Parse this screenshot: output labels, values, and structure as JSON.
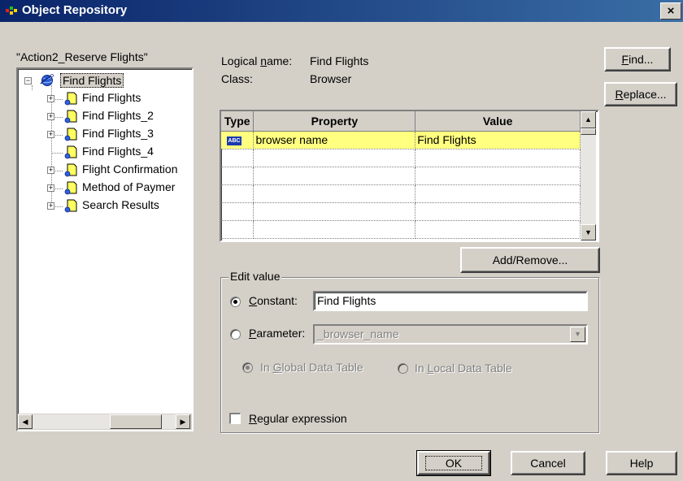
{
  "window": {
    "title": "Object Repository",
    "close_glyph": "×"
  },
  "tree": {
    "caption": "\"Action2_Reserve Flights\"",
    "root": {
      "label": "Find Flights",
      "icon": "browser-globe-icon"
    },
    "children": [
      {
        "label": "Find Flights",
        "expandable": true
      },
      {
        "label": "Find Flights_2",
        "expandable": true
      },
      {
        "label": "Find Flights_3",
        "expandable": true
      },
      {
        "label": "Find Flights_4",
        "expandable": false
      },
      {
        "label": "Flight Confirmation",
        "expandable": true
      },
      {
        "label": "Method of Paymer",
        "expandable": true
      },
      {
        "label": "Search Results",
        "expandable": true
      }
    ]
  },
  "info": {
    "logical_name_label_pre": "Logical ",
    "logical_name_label_u": "n",
    "logical_name_label_post": "ame:",
    "logical_name_value": "Find Flights",
    "class_label": "Class:",
    "class_value": "Browser"
  },
  "grid": {
    "columns": [
      "Type",
      "Property",
      "Value"
    ],
    "rows": [
      {
        "type_icon": "ABC",
        "property": "browser name",
        "value": "Find Flights",
        "selected": true
      }
    ],
    "empty_rows": 5
  },
  "buttons": {
    "find_u": "F",
    "find_rest": "ind...",
    "replace_u": "R",
    "replace_rest": "eplace...",
    "add_remove": "Add/Remove...",
    "ok": "OK",
    "cancel": "Cancel",
    "help": "Help"
  },
  "edit_value": {
    "legend": "Edit value",
    "constant_u": "C",
    "constant_rest": "onstant:",
    "constant_value": "Find Flights",
    "constant_selected": true,
    "parameter_u": "P",
    "parameter_rest": "arameter:",
    "parameter_value": "_browser_name",
    "global_pre": "In ",
    "global_u": "G",
    "global_rest": "lobal Data Table",
    "local_pre": "In ",
    "local_u": "L",
    "local_rest": "ocal Data Table",
    "regex_u": "R",
    "regex_rest": "egular expression",
    "regex_checked": false
  },
  "colors": {
    "title_bar": "#0a246a",
    "selected_row": "#ffff80",
    "dialog_bg": "#d4d0c8",
    "tree_selected": "#d4d0c8"
  }
}
